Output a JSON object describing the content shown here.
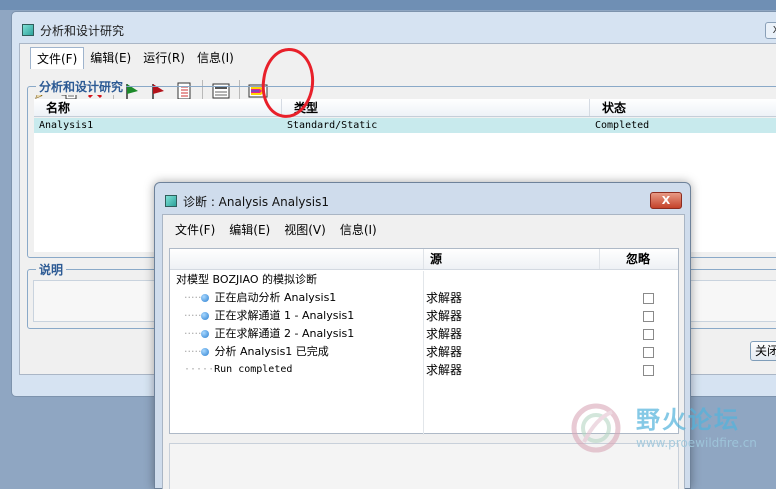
{
  "main_window": {
    "title": "分析和设计研究",
    "close_label": "X",
    "menu": [
      "文件(F)",
      "编辑(E)",
      "运行(R)",
      "信息(I)"
    ],
    "toolbar_icons": [
      "pencil-icon",
      "copy-icon",
      "delete-icon",
      "green-flag-icon",
      "red-flag-icon",
      "checklist-icon",
      "info-icon",
      "diagnostics-icon"
    ],
    "group_title": "分析和设计研究",
    "columns": [
      "名称",
      "类型",
      "状态"
    ],
    "rows": [
      {
        "name": "Analysis1",
        "type": "Standard/Static",
        "status": "Completed"
      }
    ],
    "desc_title": "说明",
    "close_button": "关闭"
  },
  "diag_window": {
    "title": "诊断 : Analysis Analysis1",
    "close_label": "X",
    "menu": [
      "文件(F)",
      "编辑(E)",
      "视图(V)",
      "信息(I)"
    ],
    "columns": [
      "",
      "源",
      "忽略"
    ],
    "root": "对模型 BOZJIAO 的模拟诊断",
    "items": [
      {
        "text": "正在启动分析 Analysis1",
        "source": "求解器"
      },
      {
        "text": "正在求解通道 1 - Analysis1",
        "source": "求解器"
      },
      {
        "text": "正在求解通道 2 - Analysis1",
        "source": "求解器"
      },
      {
        "text": "分析 Analysis1 已完成",
        "source": "求解器"
      },
      {
        "text": "Run completed",
        "source": "求解器"
      }
    ],
    "scroll_grip": "::::"
  },
  "watermark": {
    "text": "野火论坛",
    "url": "www.proewildfire.cn"
  }
}
